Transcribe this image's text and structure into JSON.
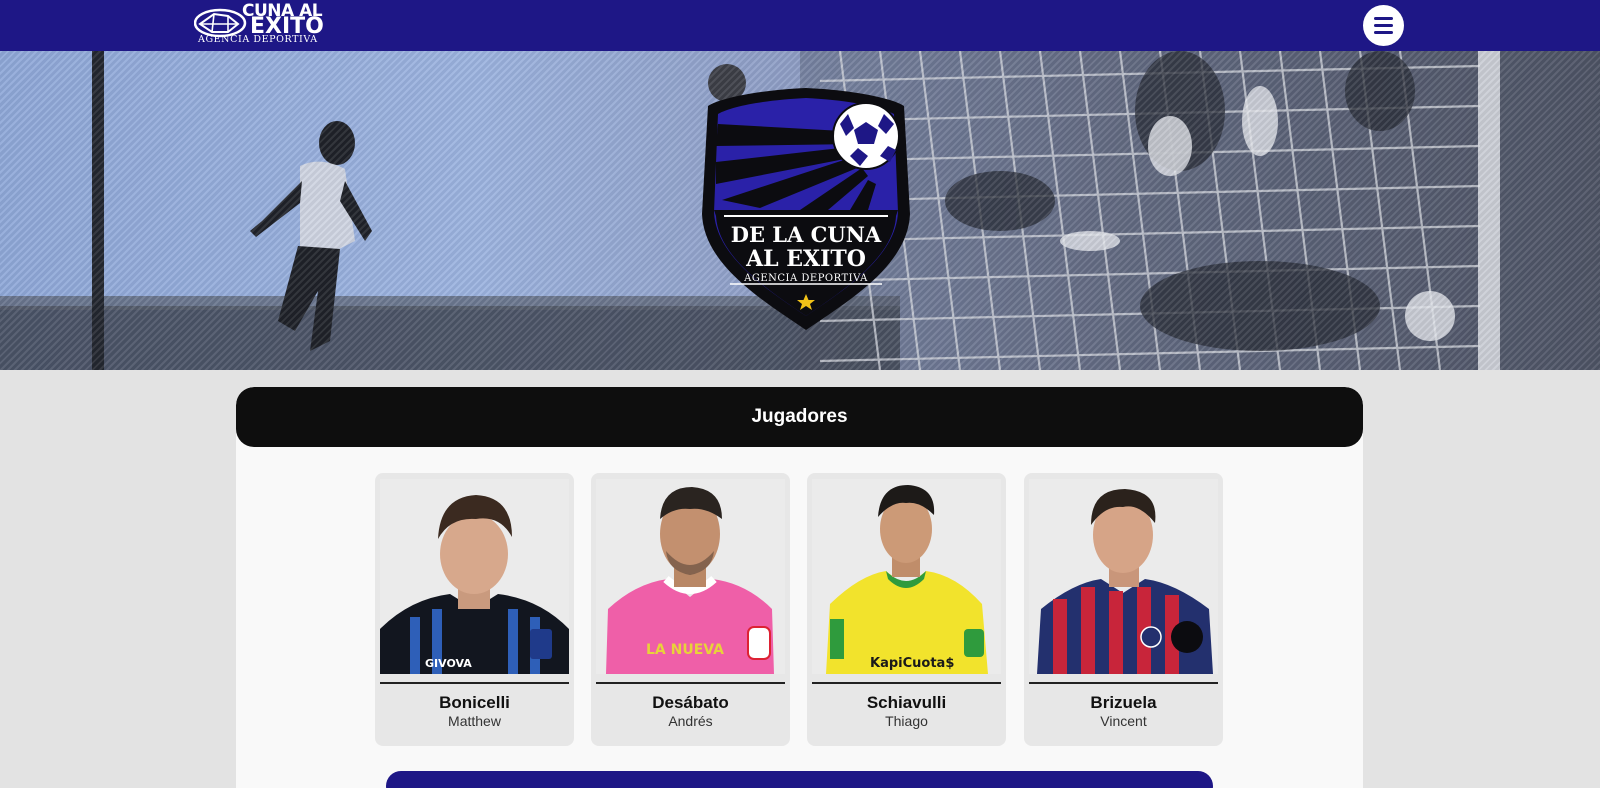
{
  "header": {
    "brand_line1": "CUNA AL",
    "brand_line2": "EXITO",
    "brand_line3": "AGENCIA DEPORTIVA",
    "menu_icon": "hamburger-icon",
    "color": "#1e1786"
  },
  "hero": {
    "crest_line1": "DE LA CUNA",
    "crest_line2": "AL EXITO",
    "crest_line3": "AGENCIA DEPORTIVA"
  },
  "section": {
    "title": "Jugadores"
  },
  "players": [
    {
      "surname": "Bonicelli",
      "first_name": "Matthew",
      "shirt_sponsor": "GIVOVA"
    },
    {
      "surname": "Desábato",
      "first_name": "Andrés",
      "shirt_sponsor": "LA NUEVA"
    },
    {
      "surname": "Schiavulli",
      "first_name": "Thiago",
      "shirt_sponsor": "KapiCuota$"
    },
    {
      "surname": "Brizuela",
      "first_name": "Vincent",
      "shirt_sponsor": ""
    }
  ]
}
